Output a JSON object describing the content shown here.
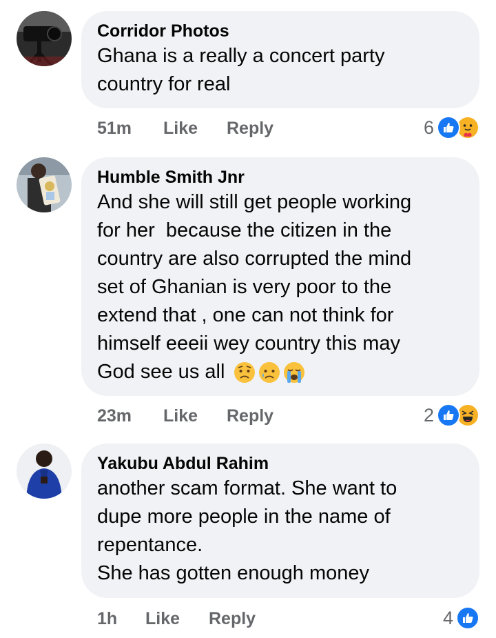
{
  "comments": [
    {
      "author": "Corridor Photos",
      "text": "Ghana is a really a concert party\ncountry for real",
      "time": "51m",
      "like_label": "Like",
      "reply_label": "Reply",
      "reaction_count": "6",
      "reaction_icons": [
        "like-icon",
        "care-icon"
      ]
    },
    {
      "author": "Humble Smith Jnr",
      "text": "And she will still get people working\nfor her  because the citizen in the\ncountry are also corrupted the mind\nset of Ghanian is very poor to the\nextend that , one can not think for\nhimself eeeii wey country this may\nGod see us all ",
      "text_emojis": [
        "worried-face-emoji",
        "sad-tear-face-emoji",
        "crying-face-emoji"
      ],
      "time": "23m",
      "like_label": "Like",
      "reply_label": "Reply",
      "reaction_count": "2",
      "reaction_icons": [
        "like-icon",
        "haha-icon"
      ]
    },
    {
      "author": "Yakubu Abdul Rahim",
      "text": "another scam format. She want to\ndupe more people in the name of\nrepentance.\nShe has gotten enough money",
      "time": "1h",
      "like_label": "Like",
      "reply_label": "Reply",
      "reaction_count": "4",
      "reaction_icons": [
        "like-icon"
      ]
    }
  ],
  "colors": {
    "bubble": "#f0f2f5",
    "secondary_text": "#65676b",
    "like_blue": "#1877f2",
    "reaction_yellow": "#f7b125"
  }
}
